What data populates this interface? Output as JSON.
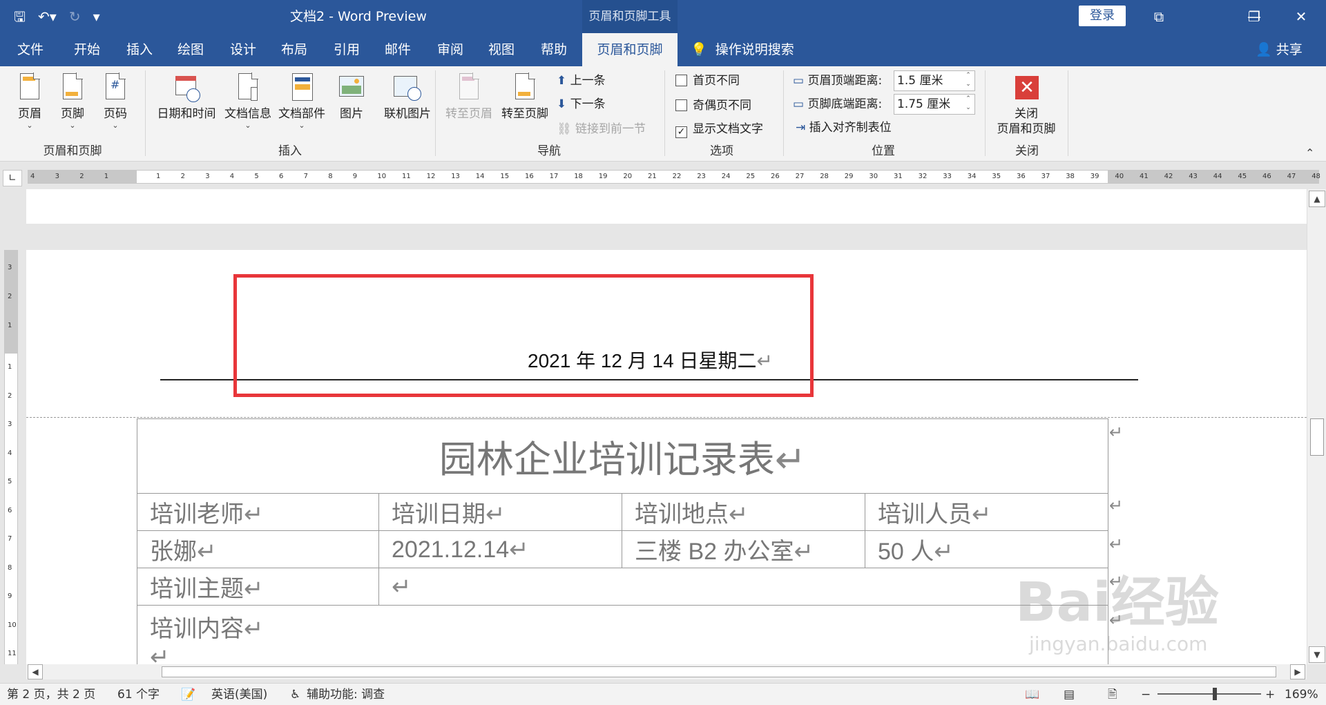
{
  "titlebar": {
    "title": "文档2  -  Word Preview",
    "context_tools": "页眉和页脚工具",
    "login": "登录"
  },
  "tabs": [
    "文件",
    "开始",
    "插入",
    "绘图",
    "设计",
    "布局",
    "引用",
    "邮件",
    "审阅",
    "视图",
    "帮助",
    "页眉和页脚"
  ],
  "search_label": "操作说明搜索",
  "share_label": "共享",
  "ribbon": {
    "group_headerfooter": {
      "label": "页眉和页脚",
      "header": "页眉",
      "footer": "页脚",
      "pagenum": "页码"
    },
    "group_insert": {
      "label": "插入",
      "datetime": "日期和时间",
      "docinfo": "文档信息",
      "parts": "文档部件",
      "picture": "图片",
      "online_picture": "联机图片"
    },
    "group_nav": {
      "label": "导航",
      "goto_header": "转至页眉",
      "goto_footer": "转至页脚",
      "prev": "上一条",
      "next": "下一条",
      "link_prev": "链接到前一节"
    },
    "group_options": {
      "label": "选项",
      "first_page": "首页不同",
      "odd_even": "奇偶页不同",
      "show_text": "显示文档文字",
      "show_text_checked": true
    },
    "group_position": {
      "label": "位置",
      "header_top_label": "页眉顶端距离:",
      "header_top_value": "1.5 厘米",
      "footer_bottom_label": "页脚底端距离:",
      "footer_bottom_value": "1.75 厘米",
      "align_tab": "插入对齐制表位"
    },
    "group_close": {
      "label": "关闭",
      "close_line1": "关闭",
      "close_line2": "页眉和页脚"
    }
  },
  "ruler": {
    "left_nums": [
      "4",
      "3",
      "2",
      "1"
    ],
    "right_nums": [
      "1",
      "2",
      "3",
      "4",
      "5",
      "6",
      "7",
      "8",
      "9",
      "10",
      "11",
      "12",
      "13",
      "14",
      "15",
      "16",
      "17",
      "18",
      "19",
      "20",
      "21",
      "22",
      "23",
      "24",
      "25",
      "26",
      "27",
      "28",
      "29",
      "30",
      "31",
      "32",
      "33",
      "34",
      "35",
      "36",
      "37",
      "38",
      "39",
      "40",
      "41",
      "42",
      "43",
      "44",
      "45",
      "46",
      "47",
      "48"
    ],
    "vnums": [
      "3",
      "2",
      "1",
      "1",
      "2",
      "3",
      "4",
      "5",
      "6",
      "7",
      "8",
      "9",
      "10",
      "11"
    ]
  },
  "document": {
    "header_text": "2021 年 12 月 14 日星期二",
    "table": {
      "title": "园林企业培训记录表",
      "row1": [
        "培训老师",
        "培训日期",
        "培训地点",
        "培训人员"
      ],
      "row2": [
        "张娜",
        "2021.12.14",
        "三楼 B2 办公室",
        "50 人"
      ],
      "row3": [
        "培训主题",
        ""
      ],
      "row4": [
        "培训内容"
      ]
    }
  },
  "status": {
    "page": "第 2 页，共 2 页",
    "words": "61 个字",
    "lang": "英语(美国)",
    "accessibility": "辅助功能: 调查",
    "zoom": "169%"
  },
  "watermark": {
    "brand": "Bai经验",
    "url": "jingyan.baidu.com"
  }
}
